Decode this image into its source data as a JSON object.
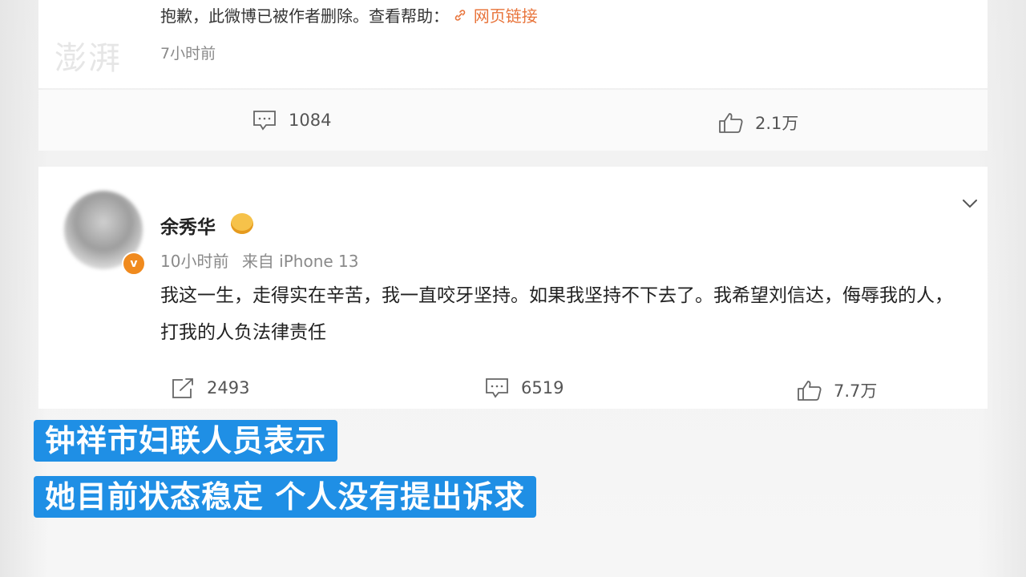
{
  "top_post": {
    "deleted_text": "抱歉，此微博已被作者删除。查看帮助：",
    "link_text": "网页链接",
    "time": "7小时前",
    "comment_count": "1084",
    "like_count": "2.1万"
  },
  "main_post": {
    "username": "余秀华",
    "time": "10小时前",
    "source": "来自 iPhone 13",
    "content": "我这一生，走得实在辛苦，我一直咬牙坚持。如果我坚持不下去了。我希望刘信达，侮辱我的人，打我的人负法律责任",
    "repost_count": "2493",
    "comment_count": "6519",
    "like_count": "7.7万",
    "verified_badge": "v"
  },
  "captions": {
    "line1": "钟祥市妇联人员表示",
    "line2": "她目前状态稳定 个人没有提出诉求"
  },
  "colors": {
    "caption_bg": "#1f8fe5",
    "link": "#e8743b",
    "verified": "#f08a1e"
  },
  "icons": [
    "link-icon",
    "comment-icon",
    "like-icon",
    "repost-icon",
    "chevron-down-icon",
    "crown-icon",
    "verified-icon"
  ]
}
